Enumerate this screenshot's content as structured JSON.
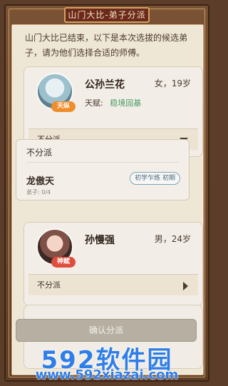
{
  "window": {
    "title": "山门大比-弟子分派"
  },
  "intro": {
    "text": "山门大比已结束，以下是本次选拔的候选弟子，请为他们选择合适的师傅。"
  },
  "candidates": [
    {
      "name": "公孙兰花",
      "gender_age": "女，19岁",
      "talent_label": "天赋:",
      "talent_value": "稳境固基",
      "badge": "天纵",
      "badge_color": "#ef8d2b",
      "select_value": "不分派"
    },
    {
      "name": "孙慢强",
      "gender_age": "男，24岁",
      "badge": "神赋",
      "badge_color": "#e04e3b",
      "select_value": "不分派"
    }
  ],
  "dropdown": {
    "option_none": "不分派",
    "mentor": {
      "name": "龙傲天",
      "rank": "初学乍练 初期",
      "disciples": "弟子: 0/4"
    }
  },
  "footer": {
    "assign_button": "确认分派"
  },
  "watermark": {
    "main": "592软件园",
    "url": "www.592xiazai.com"
  }
}
